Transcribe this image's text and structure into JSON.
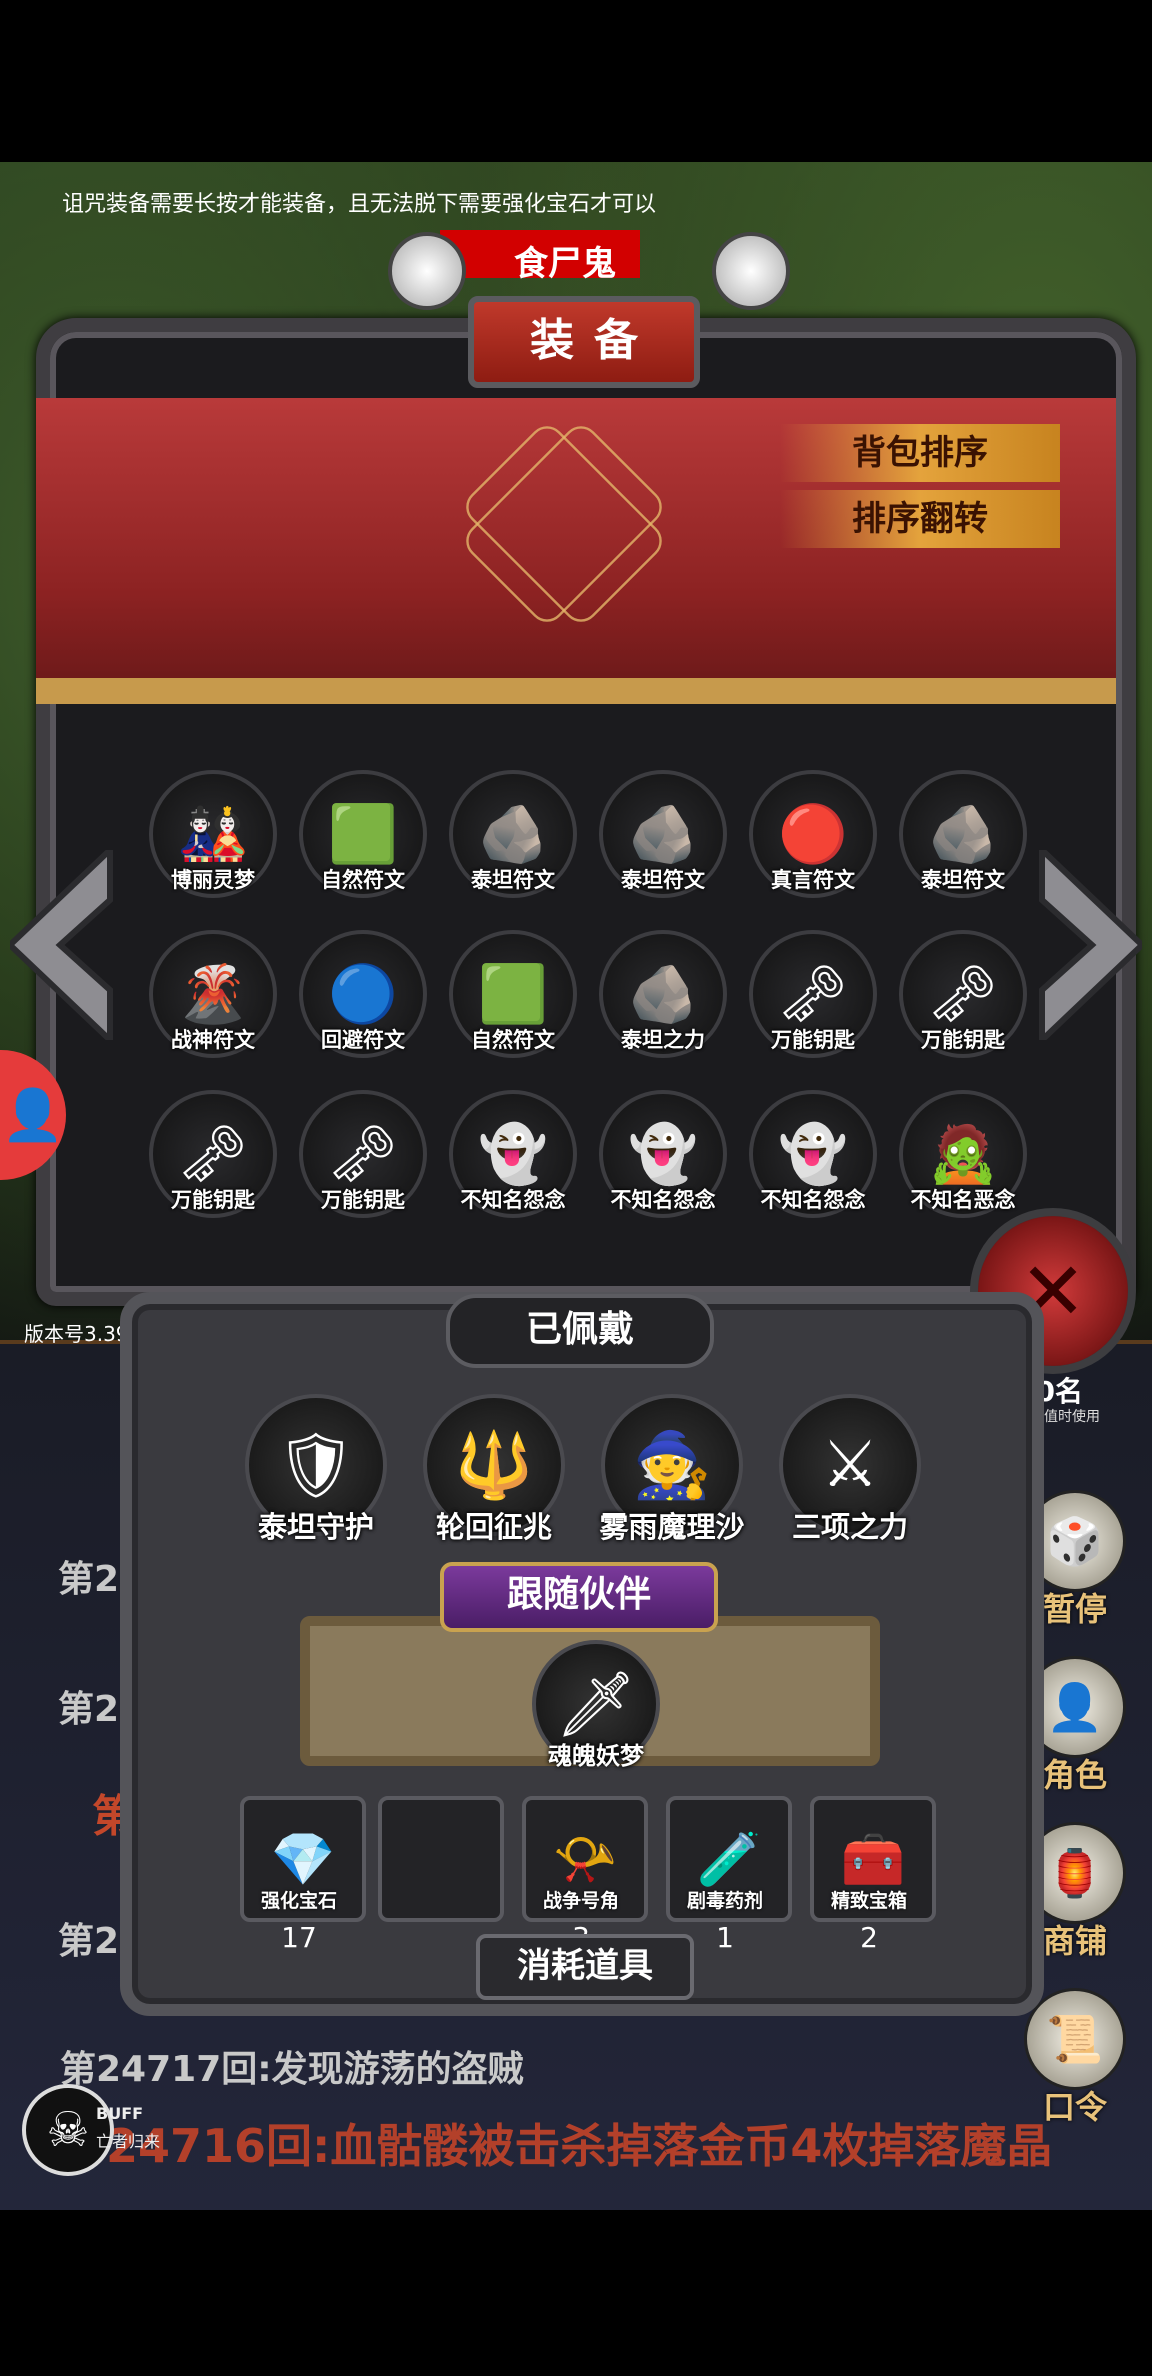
{
  "hint": "诅咒装备需要长按才能装备，且无法脱下需要强化宝石才可以",
  "monster": "食尸鬼",
  "panel_title": "装备",
  "sort_buttons": [
    "背包排序",
    "排序翻转"
  ],
  "inventory": [
    {
      "label": "博丽灵梦",
      "icon": "🎎"
    },
    {
      "label": "自然符文",
      "icon": "🟩"
    },
    {
      "label": "泰坦符文",
      "icon": "🪨"
    },
    {
      "label": "泰坦符文",
      "icon": "🪨"
    },
    {
      "label": "真言符文",
      "icon": "🔴"
    },
    {
      "label": "泰坦符文",
      "icon": "🪨"
    },
    {
      "label": "战神符文",
      "icon": "🌋"
    },
    {
      "label": "回避符文",
      "icon": "🔵"
    },
    {
      "label": "自然符文",
      "icon": "🟩"
    },
    {
      "label": "泰坦之力",
      "icon": "🪨"
    },
    {
      "label": "万能钥匙",
      "icon": "🗝"
    },
    {
      "label": "万能钥匙",
      "icon": "🗝"
    },
    {
      "label": "万能钥匙",
      "icon": "🗝"
    },
    {
      "label": "万能钥匙",
      "icon": "🗝"
    },
    {
      "label": "不知名怨念",
      "icon": "👻"
    },
    {
      "label": "不知名怨念",
      "icon": "👻"
    },
    {
      "label": "不知名怨念",
      "icon": "👻"
    },
    {
      "label": "不知名恶念",
      "icon": "🧟"
    }
  ],
  "worn_title": "已佩戴",
  "worn": [
    {
      "label": "泰坦守护",
      "icon": "🛡"
    },
    {
      "label": "轮回征兆",
      "icon": "🔱"
    },
    {
      "label": "雾雨魔理沙",
      "icon": "🧙"
    },
    {
      "label": "三项之力",
      "icon": "⚔"
    }
  ],
  "companion_title": "跟随伙伴",
  "companion": {
    "label": "魂魄妖梦",
    "icon": "🗡"
  },
  "consumables_title": "消耗道具",
  "consumables": [
    {
      "label": "强化宝石",
      "icon": "💎",
      "count": "17"
    },
    {
      "label": "",
      "icon": "",
      "count": ""
    },
    {
      "label": "战争号角",
      "icon": "📯",
      "count": "3"
    },
    {
      "label": "剧毒药剂",
      "icon": "🧪",
      "count": "1"
    },
    {
      "label": "精致宝箱",
      "icon": "🧰",
      "count": "2"
    }
  ],
  "version": "版本号3.39",
  "log": {
    "partial_1": "第2",
    "partial_2": "第247",
    "partial_3": "第",
    "partial_4": "第2",
    "line_1": "第24717回:发现游荡的盗贼",
    "line_2": "第24716回:血骷髅被击杀掉落金币4枚掉落魔晶"
  },
  "side_menu": [
    {
      "label": "暂停",
      "icon": "🎲"
    },
    {
      "label": "角色",
      "icon": "👤"
    },
    {
      "label": "商铺",
      "icon": "🏮"
    },
    {
      "label": "口令",
      "icon": "📜"
    }
  ],
  "right_num": "50名",
  "right_sub": "其数值时使用",
  "buff": {
    "label": "BUFF",
    "sub": "亡者归来"
  }
}
